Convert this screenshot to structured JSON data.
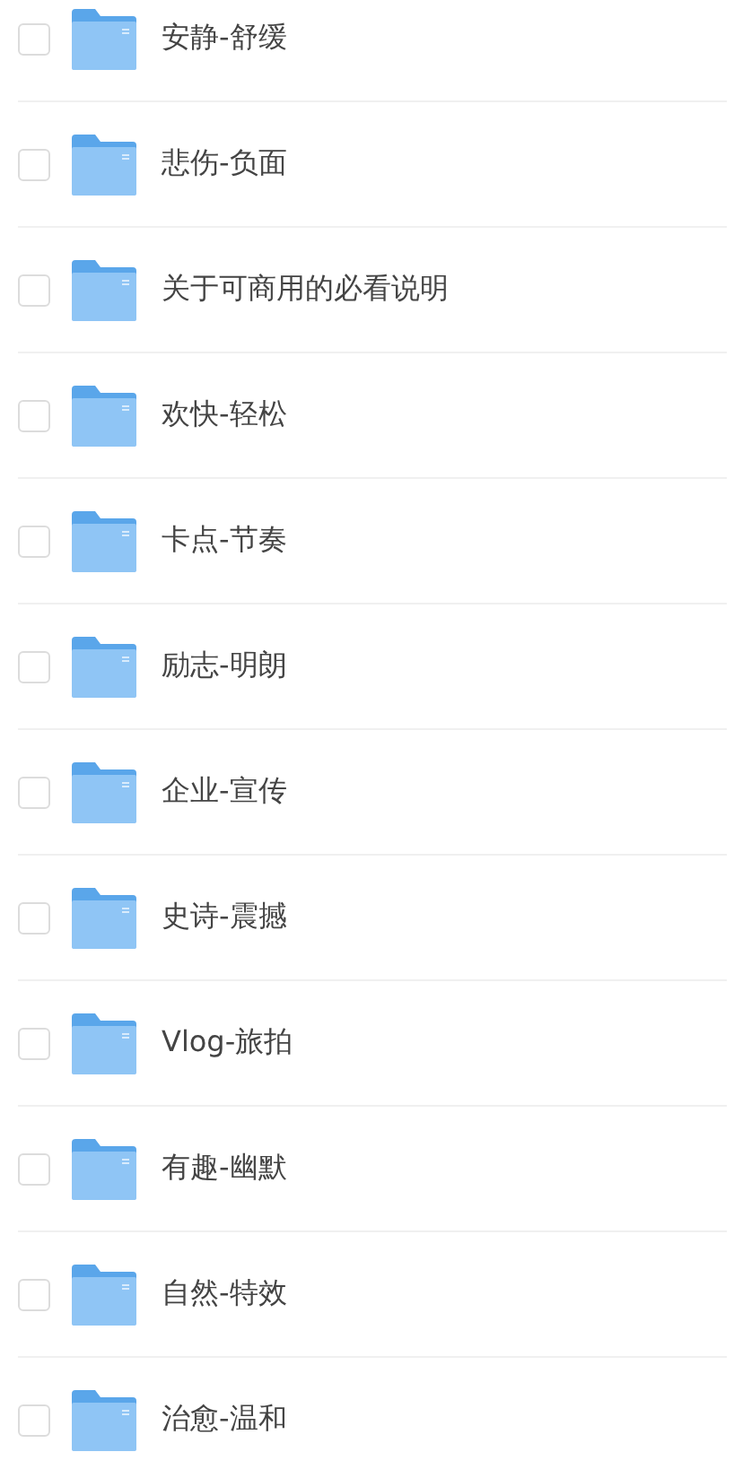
{
  "folders": [
    {
      "name": "安静-舒缓",
      "checked": false
    },
    {
      "name": "悲伤-负面",
      "checked": false
    },
    {
      "name": "关于可商用的必看说明",
      "checked": false
    },
    {
      "name": "欢快-轻松",
      "checked": false
    },
    {
      "name": "卡点-节奏",
      "checked": false
    },
    {
      "name": "励志-明朗",
      "checked": false
    },
    {
      "name": "企业-宣传",
      "checked": false
    },
    {
      "name": "史诗-震撼",
      "checked": false
    },
    {
      "name": "Vlog-旅拍",
      "checked": false
    },
    {
      "name": "有趣-幽默",
      "checked": false
    },
    {
      "name": "自然-特效",
      "checked": false
    },
    {
      "name": "治愈-温和",
      "checked": false
    }
  ]
}
